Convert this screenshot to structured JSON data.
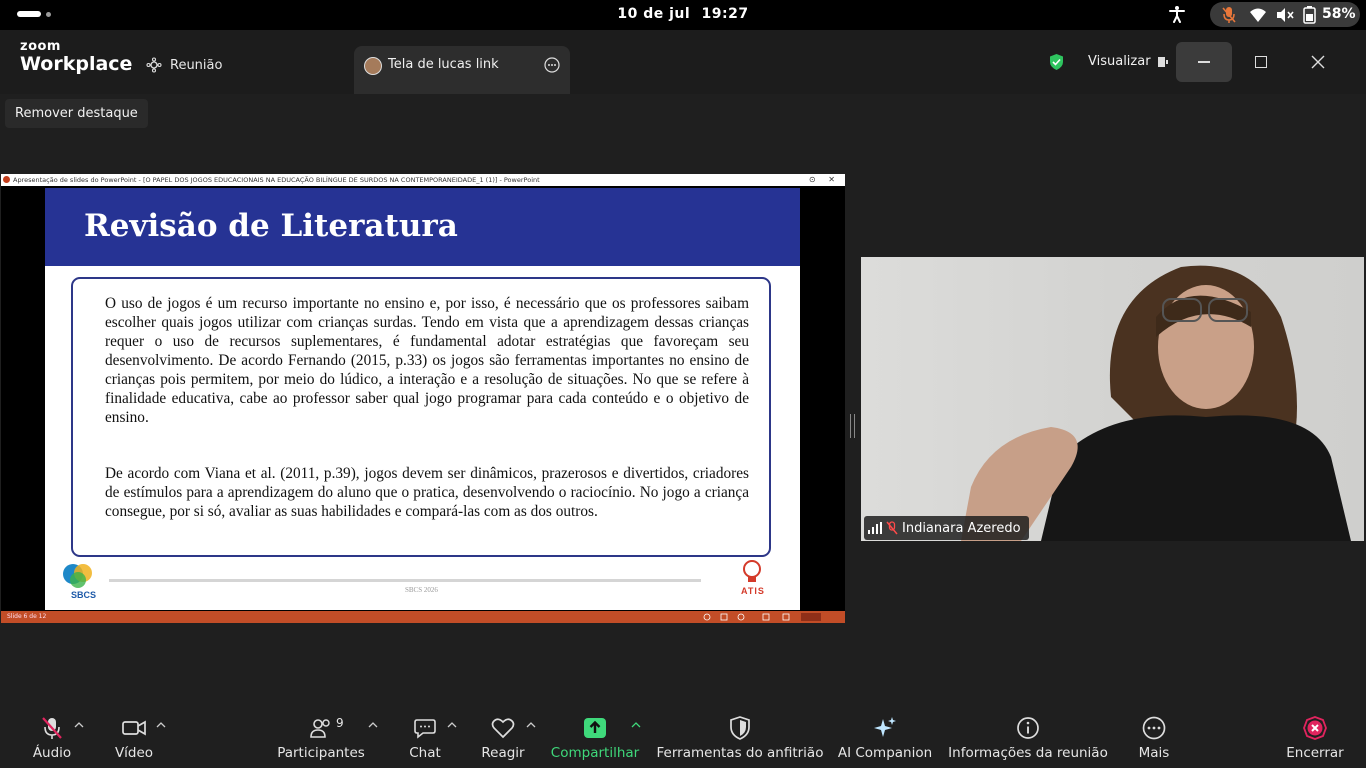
{
  "status_bar": {
    "date": "10 de jul",
    "time": "19:27",
    "battery": "58%"
  },
  "app": {
    "logo_top": "zoom",
    "logo_bottom": "Workplace",
    "tab_meeting": "Reunião",
    "tab_share": "Tela de lucas link",
    "view_label": "Visualizar"
  },
  "spotlight": {
    "remove_label": "Remover destaque"
  },
  "shared_screen": {
    "ppt_title": "Apresentação de slides do PowerPoint - [O PAPEL DOS JOGOS EDUCACIONAIS NA EDUCAÇÃO BILÍNGUE DE SURDOS NA CONTEMPORANEIDADE_1 (1)] - PowerPoint",
    "slide_title": "Revisão de Literatura",
    "paragraph1": "O uso de jogos é um recurso importante no ensino e, por isso, é necessário que os professores saibam escolher quais jogos utilizar com crianças surdas. Tendo em vista que a aprendizagem dessas crianças requer o uso de recursos suplementares, é fundamental adotar estratégias que favoreçam seu desenvolvimento. De acordo Fernando (2015, p.33) os jogos são ferramentas importantes no ensino de crianças pois permitem, por meio do lúdico, a interação e a resolução de situações. No que se refere à finalidade educativa, cabe ao professor saber qual jogo programar para cada conteúdo e o objetivo de ensino.",
    "paragraph2": "De acordo com Viana et al. (2011, p.39), jogos devem ser dinâmicos, prazerosos e divertidos, criadores de estímulos para a aprendizagem do aluno que o pratica, desenvolvendo o raciocínio. No jogo a criança consegue, por si só, avaliar as suas habilidades e compará-las com as dos outros.",
    "footer_text": "SBCS 2026",
    "logo_left": "SBCS",
    "logo_right": "ATIS",
    "slide_counter": "Slide 6 de 12"
  },
  "participant": {
    "name": "Indianara Azeredo"
  },
  "toolbar": {
    "audio": "Áudio",
    "video": "Vídeo",
    "participants": "Participantes",
    "participants_count": "9",
    "chat": "Chat",
    "react": "Reagir",
    "share": "Compartilhar",
    "host_tools": "Ferramentas do anfitrião",
    "ai_companion": "AI Companion",
    "meeting_info": "Informações da reunião",
    "more": "Mais",
    "end": "Encerrar"
  },
  "colors": {
    "share_green": "#3fd97b",
    "end_red": "#e0245e",
    "slide_header": "#263394"
  }
}
